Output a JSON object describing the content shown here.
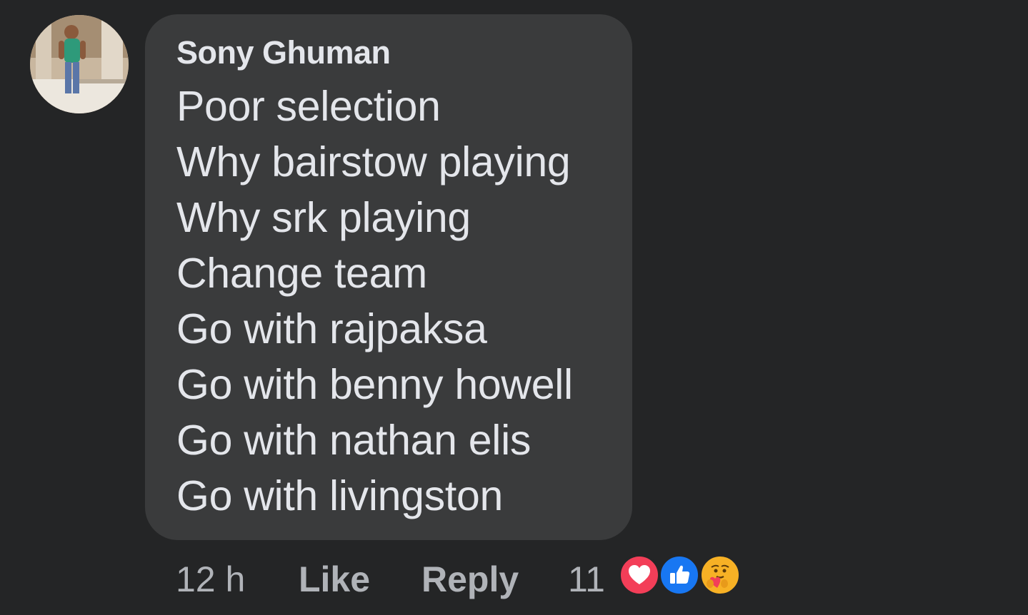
{
  "comment": {
    "author": "Sony Ghuman",
    "lines": [
      "Poor selection",
      "Why bairstow playing",
      "Why srk playing",
      "Change team",
      "Go with rajpaksa",
      "Go with benny howell",
      "Go with nathan elis",
      "Go with livingston"
    ]
  },
  "meta": {
    "timestamp": "12 h",
    "like_label": "Like",
    "reply_label": "Reply",
    "reaction_count": "11"
  },
  "reactions": [
    "love-reaction-icon",
    "like-reaction-icon",
    "care-reaction-icon"
  ],
  "colors": {
    "background": "#242526",
    "bubble": "#3a3b3c",
    "text": "#e4e6eb",
    "meta_text": "#b0b3b8",
    "love": "#f33e58",
    "like": "#1877f2",
    "care": "#f7b125"
  }
}
